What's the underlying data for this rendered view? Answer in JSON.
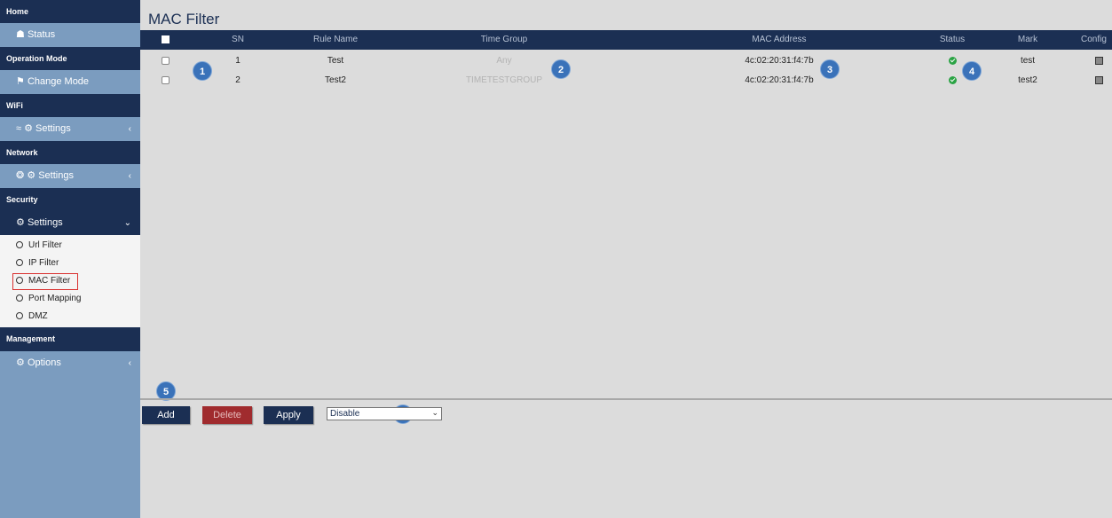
{
  "sidebar": {
    "home": "Home",
    "status": "Status",
    "operation_mode": "Operation Mode",
    "change_mode": "Change Mode",
    "wifi": "WiFi",
    "wifi_settings": "Settings",
    "network": "Network",
    "network_settings": "Settings",
    "security": "Security",
    "security_settings": "Settings",
    "security_items": [
      "Url Filter",
      "IP Filter",
      "MAC Filter",
      "Port Mapping",
      "DMZ"
    ],
    "management": "Management",
    "options": "Options"
  },
  "page": {
    "title": "MAC Filter"
  },
  "table": {
    "headers": [
      "SN",
      "Rule Name",
      "Time Group",
      "MAC Address",
      "Status",
      "Mark",
      "Config"
    ],
    "rows": [
      {
        "sn": "1",
        "rule_name": "Test",
        "time_group": "Any",
        "mac": "4c:02:20:31:f4:7b",
        "mark": "test"
      },
      {
        "sn": "2",
        "rule_name": "Test2",
        "time_group": "TIMETESTGROUP",
        "mac": "4c:02:20:31:f4:7b",
        "mark": "test2"
      }
    ]
  },
  "annotations": [
    "1",
    "2",
    "3",
    "4",
    "5",
    "6"
  ],
  "actions": {
    "add": "Add",
    "delete": "Delete",
    "apply": "Apply",
    "mode_selected": "Disable"
  },
  "colors": {
    "navy": "#1b2f53",
    "sidebar": "#7b9cbf",
    "delete_red": "#a02b2e",
    "badge": "#3a72b9",
    "ok_green": "#2aa344"
  }
}
